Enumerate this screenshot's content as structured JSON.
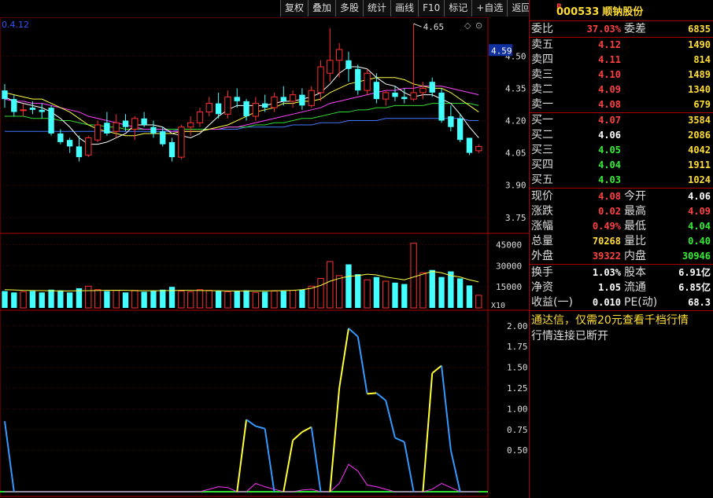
{
  "toolbar": [
    "复权",
    "叠加",
    "多股",
    "统计",
    "画线",
    "F10",
    "标记",
    "+自选",
    "返回"
  ],
  "chart": {
    "top_left_label": "0.4.12",
    "price_axis": [
      "4.50",
      "4.35",
      "4.20",
      "4.05",
      "3.90",
      "3.75"
    ],
    "current_price_tag": "4.59",
    "high_label": "4.65",
    "volume_axis": [
      "45000",
      "30000",
      "15000"
    ],
    "volume_unit": "X10",
    "indicator_axis": [
      "2.00",
      "1.75",
      "1.50",
      "1.25",
      "1.00",
      "0.75",
      "0.50"
    ],
    "colors": {
      "up": "#ff3030",
      "down": "#44ffff",
      "ma5": "#ffffff",
      "ma10": "#ffff44",
      "ma20": "#ff44ff",
      "ma30": "#33dd33",
      "ma60": "#4477ff"
    }
  },
  "chart_data": {
    "type": "candlestick",
    "ylim": [
      3.68,
      4.68
    ],
    "candles": [
      {
        "o": 4.34,
        "h": 4.37,
        "l": 4.26,
        "c": 4.3
      },
      {
        "o": 4.3,
        "h": 4.32,
        "l": 4.22,
        "c": 4.24
      },
      {
        "o": 4.25,
        "h": 4.28,
        "l": 4.22,
        "c": 4.25
      },
      {
        "o": 4.26,
        "h": 4.29,
        "l": 4.23,
        "c": 4.25
      },
      {
        "o": 4.25,
        "h": 4.28,
        "l": 4.21,
        "c": 4.24
      },
      {
        "o": 4.26,
        "h": 4.27,
        "l": 4.13,
        "c": 4.14
      },
      {
        "o": 4.14,
        "h": 4.16,
        "l": 4.09,
        "c": 4.1
      },
      {
        "o": 4.11,
        "h": 4.12,
        "l": 4.05,
        "c": 4.08
      },
      {
        "o": 4.08,
        "h": 4.13,
        "l": 4.01,
        "c": 4.03
      },
      {
        "o": 4.04,
        "h": 4.13,
        "l": 4.03,
        "c": 4.12
      },
      {
        "o": 4.11,
        "h": 4.2,
        "l": 4.1,
        "c": 4.18
      },
      {
        "o": 4.19,
        "h": 4.24,
        "l": 4.13,
        "c": 4.14
      },
      {
        "o": 4.15,
        "h": 4.23,
        "l": 4.12,
        "c": 4.19
      },
      {
        "o": 4.2,
        "h": 4.23,
        "l": 4.15,
        "c": 4.17
      },
      {
        "o": 4.16,
        "h": 4.22,
        "l": 4.11,
        "c": 4.21
      },
      {
        "o": 4.21,
        "h": 4.24,
        "l": 4.17,
        "c": 4.18
      },
      {
        "o": 4.17,
        "h": 4.2,
        "l": 4.12,
        "c": 4.14
      },
      {
        "o": 4.15,
        "h": 4.17,
        "l": 4.08,
        "c": 4.09
      },
      {
        "o": 4.1,
        "h": 4.12,
        "l": 4.01,
        "c": 4.03
      },
      {
        "o": 4.03,
        "h": 4.18,
        "l": 4.02,
        "c": 4.17
      },
      {
        "o": 4.17,
        "h": 4.22,
        "l": 4.13,
        "c": 4.19
      },
      {
        "o": 4.19,
        "h": 4.26,
        "l": 4.17,
        "c": 4.24
      },
      {
        "o": 4.24,
        "h": 4.31,
        "l": 4.22,
        "c": 4.28
      },
      {
        "o": 4.28,
        "h": 4.33,
        "l": 4.21,
        "c": 4.23
      },
      {
        "o": 4.23,
        "h": 4.34,
        "l": 4.21,
        "c": 4.31
      },
      {
        "o": 4.31,
        "h": 4.35,
        "l": 4.26,
        "c": 4.29
      },
      {
        "o": 4.29,
        "h": 4.3,
        "l": 4.2,
        "c": 4.22
      },
      {
        "o": 4.22,
        "h": 4.31,
        "l": 4.2,
        "c": 4.28
      },
      {
        "o": 4.28,
        "h": 4.32,
        "l": 4.24,
        "c": 4.26
      },
      {
        "o": 4.26,
        "h": 4.33,
        "l": 4.24,
        "c": 4.31
      },
      {
        "o": 4.31,
        "h": 4.36,
        "l": 4.27,
        "c": 4.29
      },
      {
        "o": 4.29,
        "h": 4.34,
        "l": 4.26,
        "c": 4.32
      },
      {
        "o": 4.32,
        "h": 4.35,
        "l": 4.25,
        "c": 4.27
      },
      {
        "o": 4.27,
        "h": 4.36,
        "l": 4.26,
        "c": 4.34
      },
      {
        "o": 4.33,
        "h": 4.48,
        "l": 4.29,
        "c": 4.45
      },
      {
        "o": 4.42,
        "h": 4.63,
        "l": 4.38,
        "c": 4.48
      },
      {
        "o": 4.48,
        "h": 4.56,
        "l": 4.4,
        "c": 4.53
      },
      {
        "o": 4.48,
        "h": 4.52,
        "l": 4.38,
        "c": 4.44
      },
      {
        "o": 4.44,
        "h": 4.46,
        "l": 4.32,
        "c": 4.34
      },
      {
        "o": 4.34,
        "h": 4.44,
        "l": 4.32,
        "c": 4.42
      },
      {
        "o": 4.38,
        "h": 4.42,
        "l": 4.28,
        "c": 4.3
      },
      {
        "o": 4.3,
        "h": 4.34,
        "l": 4.27,
        "c": 4.33
      },
      {
        "o": 4.33,
        "h": 4.36,
        "l": 4.29,
        "c": 4.31
      },
      {
        "o": 4.31,
        "h": 4.35,
        "l": 4.28,
        "c": 4.3
      },
      {
        "o": 4.3,
        "h": 4.65,
        "l": 4.29,
        "c": 4.33
      },
      {
        "o": 4.33,
        "h": 4.38,
        "l": 4.3,
        "c": 4.35
      },
      {
        "o": 4.38,
        "h": 4.4,
        "l": 4.31,
        "c": 4.33
      },
      {
        "o": 4.33,
        "h": 4.35,
        "l": 4.19,
        "c": 4.2
      },
      {
        "o": 4.22,
        "h": 4.27,
        "l": 4.15,
        "c": 4.17
      },
      {
        "o": 4.21,
        "h": 4.23,
        "l": 4.1,
        "c": 4.11
      },
      {
        "o": 4.12,
        "h": 4.12,
        "l": 4.04,
        "c": 4.05
      },
      {
        "o": 4.06,
        "h": 4.09,
        "l": 4.05,
        "c": 4.08
      }
    ],
    "ma5": [
      4.31,
      4.29,
      4.28,
      4.27,
      4.26,
      4.24,
      4.21,
      4.17,
      4.12,
      4.09,
      4.09,
      4.1,
      4.12,
      4.14,
      4.18,
      4.18,
      4.18,
      4.17,
      4.14,
      4.13,
      4.12,
      4.14,
      4.18,
      4.22,
      4.25,
      4.27,
      4.27,
      4.27,
      4.27,
      4.28,
      4.29,
      4.29,
      4.3,
      4.31,
      4.33,
      4.37,
      4.42,
      4.45,
      4.45,
      4.44,
      4.4,
      4.37,
      4.36,
      4.33,
      4.31,
      4.32,
      4.32,
      4.3,
      4.28,
      4.23,
      4.17,
      4.12
    ],
    "ma10": [
      4.33,
      4.32,
      4.31,
      4.3,
      4.3,
      4.28,
      4.26,
      4.24,
      4.21,
      4.18,
      4.16,
      4.15,
      4.14,
      4.13,
      4.13,
      4.14,
      4.14,
      4.14,
      4.14,
      4.15,
      4.15,
      4.15,
      4.16,
      4.17,
      4.18,
      4.2,
      4.22,
      4.24,
      4.25,
      4.26,
      4.28,
      4.28,
      4.29,
      4.29,
      4.3,
      4.33,
      4.35,
      4.37,
      4.38,
      4.39,
      4.4,
      4.4,
      4.4,
      4.39,
      4.37,
      4.36,
      4.35,
      4.35,
      4.33,
      4.3,
      4.27,
      4.24
    ],
    "ma20": [
      4.3,
      4.29,
      4.29,
      4.28,
      4.28,
      4.27,
      4.26,
      4.25,
      4.24,
      4.22,
      4.21,
      4.2,
      4.19,
      4.18,
      4.17,
      4.16,
      4.16,
      4.16,
      4.15,
      4.15,
      4.15,
      4.15,
      4.16,
      4.16,
      4.17,
      4.17,
      4.18,
      4.19,
      4.2,
      4.21,
      4.22,
      4.23,
      4.24,
      4.25,
      4.26,
      4.28,
      4.29,
      4.3,
      4.31,
      4.32,
      4.33,
      4.34,
      4.34,
      4.35,
      4.35,
      4.36,
      4.36,
      4.36,
      4.35,
      4.34,
      4.33,
      4.32
    ],
    "ma30": [
      4.22,
      4.22,
      4.22,
      4.21,
      4.21,
      4.21,
      4.2,
      4.2,
      4.19,
      4.18,
      4.18,
      4.17,
      4.17,
      4.16,
      4.16,
      4.16,
      4.16,
      4.16,
      4.16,
      4.16,
      4.16,
      4.16,
      4.16,
      4.16,
      4.17,
      4.17,
      4.17,
      4.18,
      4.18,
      4.19,
      4.19,
      4.2,
      4.21,
      4.21,
      4.22,
      4.23,
      4.24,
      4.24,
      4.25,
      4.25,
      4.26,
      4.26,
      4.27,
      4.27,
      4.27,
      4.27,
      4.28,
      4.28,
      4.28,
      4.28,
      4.28,
      4.27
    ],
    "ma60": [
      4.15,
      4.15,
      4.15,
      4.15,
      4.15,
      4.15,
      4.15,
      4.15,
      4.15,
      4.15,
      4.15,
      4.15,
      4.15,
      4.15,
      4.15,
      4.15,
      4.15,
      4.15,
      4.15,
      4.16,
      4.16,
      4.16,
      4.16,
      4.16,
      4.16,
      4.16,
      4.17,
      4.17,
      4.17,
      4.17,
      4.17,
      4.18,
      4.18,
      4.18,
      4.19,
      4.19,
      4.19,
      4.2,
      4.2,
      4.2,
      4.2,
      4.21,
      4.21,
      4.21,
      4.21,
      4.21,
      4.21,
      4.21,
      4.21,
      4.21,
      4.2,
      4.2
    ],
    "volume_ylim": [
      0,
      52000
    ],
    "volume": [
      12000,
      11000,
      11500,
      12000,
      11000,
      13000,
      12500,
      11000,
      14000,
      15500,
      13000,
      12000,
      12500,
      11000,
      12500,
      11500,
      12000,
      13000,
      15000,
      12000,
      11500,
      13000,
      12500,
      12000,
      11500,
      12000,
      12500,
      11000,
      11500,
      12000,
      12000,
      12500,
      13000,
      15500,
      21000,
      33000,
      23000,
      31000,
      24000,
      20000,
      22000,
      19000,
      18000,
      17000,
      46000,
      25000,
      27000,
      22000,
      26000,
      21000,
      16000,
      9000
    ],
    "volume_ma": [
      13000,
      12800,
      12500,
      12400,
      12300,
      12200,
      12100,
      12100,
      12200,
      12300,
      12400,
      12500,
      12600,
      12500,
      12300,
      12200,
      12200,
      12300,
      12400,
      12500,
      12500,
      12400,
      12300,
      12200,
      12100,
      12100,
      12100,
      12100,
      12100,
      12200,
      12300,
      12500,
      13000,
      14000,
      16000,
      19000,
      21000,
      22500,
      23000,
      24000,
      23500,
      22000,
      21000,
      20000,
      22000,
      24000,
      26000,
      25000,
      23000,
      22000,
      20000,
      18500
    ],
    "indicator_ylim": [
      0,
      2.15
    ],
    "indicator_main": [
      0.85,
      0.0,
      0,
      0,
      0,
      0,
      0,
      0,
      0,
      0,
      0,
      0,
      0,
      0,
      0,
      0,
      0,
      0,
      0,
      0,
      0,
      0,
      0,
      0,
      0,
      0,
      0.87,
      0.79,
      0.76,
      0,
      0,
      0.62,
      0.72,
      0.78,
      0,
      0,
      1.25,
      1.97,
      1.87,
      1.18,
      1.19,
      1.1,
      0.65,
      0.6,
      0,
      0,
      1.43,
      1.52,
      0.5,
      0,
      0,
      0
    ],
    "indicator_main_up": [
      true,
      false,
      false,
      false,
      false,
      false,
      false,
      false,
      false,
      false,
      false,
      false,
      false,
      false,
      false,
      false,
      false,
      false,
      false,
      false,
      false,
      false,
      false,
      false,
      false,
      false,
      true,
      false,
      false,
      false,
      false,
      true,
      true,
      true,
      false,
      false,
      true,
      true,
      false,
      false,
      true,
      false,
      false,
      false,
      false,
      false,
      true,
      true,
      false,
      false,
      false,
      false
    ],
    "indicator_magenta": [
      0,
      0,
      0,
      0,
      0,
      0,
      0,
      0,
      0,
      0,
      0,
      0,
      0,
      0,
      0,
      0,
      0,
      0,
      0,
      0,
      0,
      0,
      0.03,
      0.06,
      0.05,
      0,
      0,
      0.1,
      0.06,
      0.03,
      0,
      0,
      0.02,
      0.03,
      0,
      0,
      0.1,
      0.33,
      0.25,
      0.08,
      0.06,
      0.03,
      0,
      0,
      0,
      0,
      0.03,
      0.1,
      0.05,
      0,
      0,
      0
    ]
  },
  "panel": {
    "flag": "R",
    "code": "000533",
    "name": "顺钠股份",
    "ratio": {
      "label1": "委比",
      "value1": "37.03%",
      "label2": "委差",
      "value2": "6835"
    },
    "sell": [
      {
        "label": "卖五",
        "price": "4.12",
        "vol": "1490"
      },
      {
        "label": "卖四",
        "price": "4.11",
        "vol": "814"
      },
      {
        "label": "卖三",
        "price": "4.10",
        "vol": "1489"
      },
      {
        "label": "卖二",
        "price": "4.09",
        "vol": "1340"
      },
      {
        "label": "卖一",
        "price": "4.08",
        "vol": "679"
      }
    ],
    "buy": [
      {
        "label": "买一",
        "price": "4.07",
        "vol": "3584",
        "pcolor": "red"
      },
      {
        "label": "买二",
        "price": "4.06",
        "vol": "2086",
        "pcolor": "white"
      },
      {
        "label": "买三",
        "price": "4.05",
        "vol": "4042",
        "pcolor": "green"
      },
      {
        "label": "买四",
        "price": "4.04",
        "vol": "1911",
        "pcolor": "green"
      },
      {
        "label": "买五",
        "price": "4.03",
        "vol": "1024",
        "pcolor": "green"
      }
    ],
    "quote": [
      {
        "l1": "现价",
        "v1": "4.08",
        "c1": "red",
        "l2": "今开",
        "v2": "4.06",
        "c2": "white"
      },
      {
        "l1": "涨跌",
        "v1": "0.02",
        "c1": "red",
        "l2": "最高",
        "v2": "4.09",
        "c2": "red"
      },
      {
        "l1": "涨幅",
        "v1": "0.49%",
        "c1": "red",
        "l2": "最低",
        "v2": "4.04",
        "c2": "green"
      },
      {
        "l1": "总量",
        "v1": "70268",
        "c1": "yellow",
        "l2": "量比",
        "v2": "0.40",
        "c2": "green"
      },
      {
        "l1": "外盘",
        "v1": "39322",
        "c1": "red",
        "l2": "内盘",
        "v2": "30946",
        "c2": "green"
      }
    ],
    "finance": [
      {
        "l1": "换手",
        "v1": "1.03%",
        "l2": "股本",
        "v2": "6.91亿"
      },
      {
        "l1": "净资",
        "v1": "1.05",
        "l2": "流通",
        "v2": "6.85亿"
      },
      {
        "l1": "收益(一)",
        "v1": "0.010",
        "l2": "PE(动)",
        "v2": "68.3"
      }
    ],
    "notice1": "通达信，仅需20元查看千档行情",
    "notice2": "行情连接已断开"
  }
}
